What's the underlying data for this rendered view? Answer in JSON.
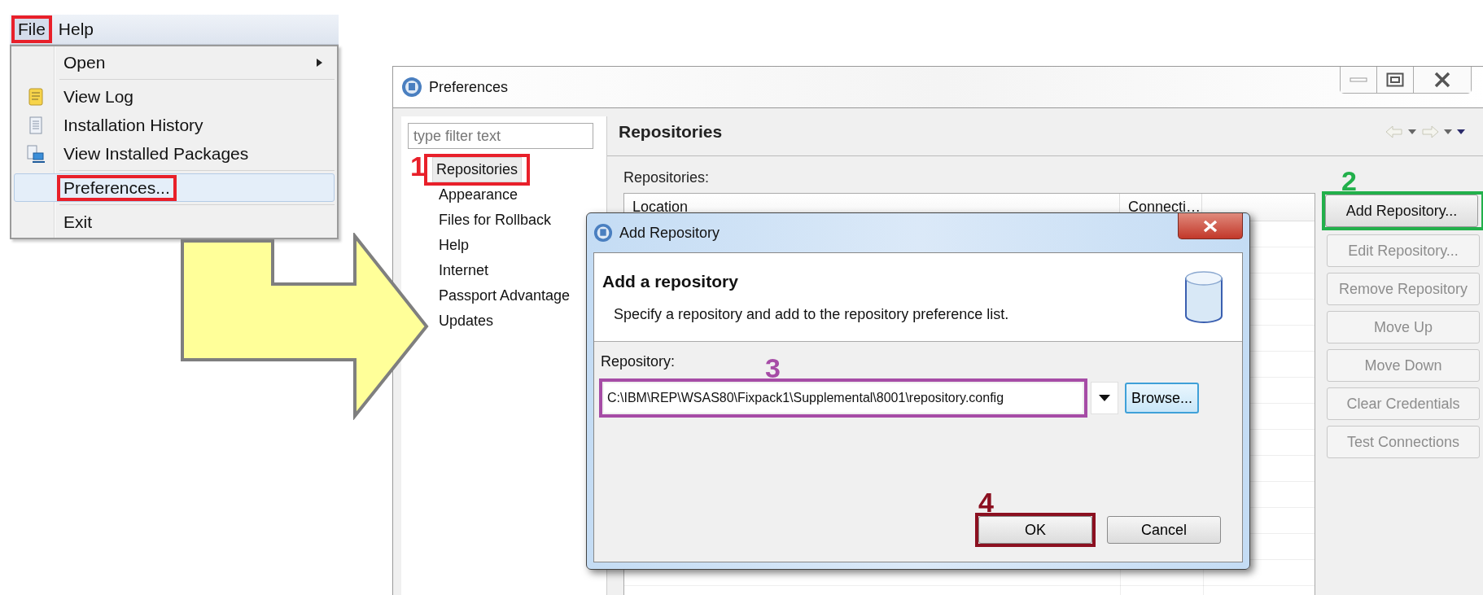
{
  "menu_bar": {
    "items": [
      {
        "label": "File",
        "selected": true,
        "highlight": {
          "color": "#e8202a"
        }
      },
      {
        "label": "Help",
        "selected": false
      }
    ]
  },
  "file_menu": {
    "items": [
      {
        "kind": "submenu",
        "label": "Open",
        "selected": false
      },
      {
        "kind": "separator"
      },
      {
        "kind": "item",
        "label": "View Log",
        "selected": false
      },
      {
        "kind": "item",
        "label": "Installation History",
        "selected": false
      },
      {
        "kind": "item",
        "label": "View Installed Packages",
        "selected": false
      },
      {
        "kind": "separator"
      },
      {
        "kind": "item",
        "label": "Preferences...",
        "selected": true,
        "highlight": {
          "color": "#e8202a"
        }
      },
      {
        "kind": "separator"
      },
      {
        "kind": "item",
        "label": "Exit",
        "selected": false
      }
    ]
  },
  "preferences_window": {
    "title": "Preferences",
    "filter": {
      "placeholder": "type filter text"
    },
    "nav": [
      {
        "label": "Repositories",
        "selected": true,
        "highlight": {
          "number": "1",
          "color": "#e8202a"
        }
      },
      {
        "label": "Appearance",
        "selected": false
      },
      {
        "label": "Files for Rollback",
        "selected": false
      },
      {
        "label": "Help",
        "selected": false
      },
      {
        "label": "Internet",
        "selected": false
      },
      {
        "label": "Passport Advantage",
        "selected": false
      },
      {
        "label": "Updates",
        "selected": false
      }
    ],
    "page_title": "Repositories",
    "section_label": "Repositories:",
    "table": {
      "columns": [
        "Location",
        "Connecti…"
      ]
    },
    "buttons": [
      {
        "label": "Add Repository...",
        "disabled": false,
        "highlight": {
          "number": "2",
          "color": "#22b04b"
        }
      },
      {
        "label": "Edit Repository...",
        "disabled": true
      },
      {
        "label": "Remove Repository",
        "disabled": true
      },
      {
        "label": "Move Up",
        "disabled": true
      },
      {
        "label": "Move Down",
        "disabled": true
      },
      {
        "label": "Clear Credentials",
        "disabled": true
      },
      {
        "label": "Test Connections",
        "disabled": true
      }
    ]
  },
  "dialog": {
    "title": "Add Repository",
    "heading": "Add a repository",
    "description": "Specify a repository and add to the repository preference list.",
    "field_label": "Repository:",
    "field": {
      "value": "C:\\IBM\\REP\\WSAS80\\Fixpack1\\Supplemental\\8001\\repository.config",
      "highlight": {
        "number": "3",
        "color": "#a64ca6"
      }
    },
    "browse": "Browse...",
    "buttons": [
      {
        "label": "OK",
        "highlight": {
          "number": "4",
          "color": "#8b1020"
        }
      },
      {
        "label": "Cancel"
      }
    ]
  }
}
